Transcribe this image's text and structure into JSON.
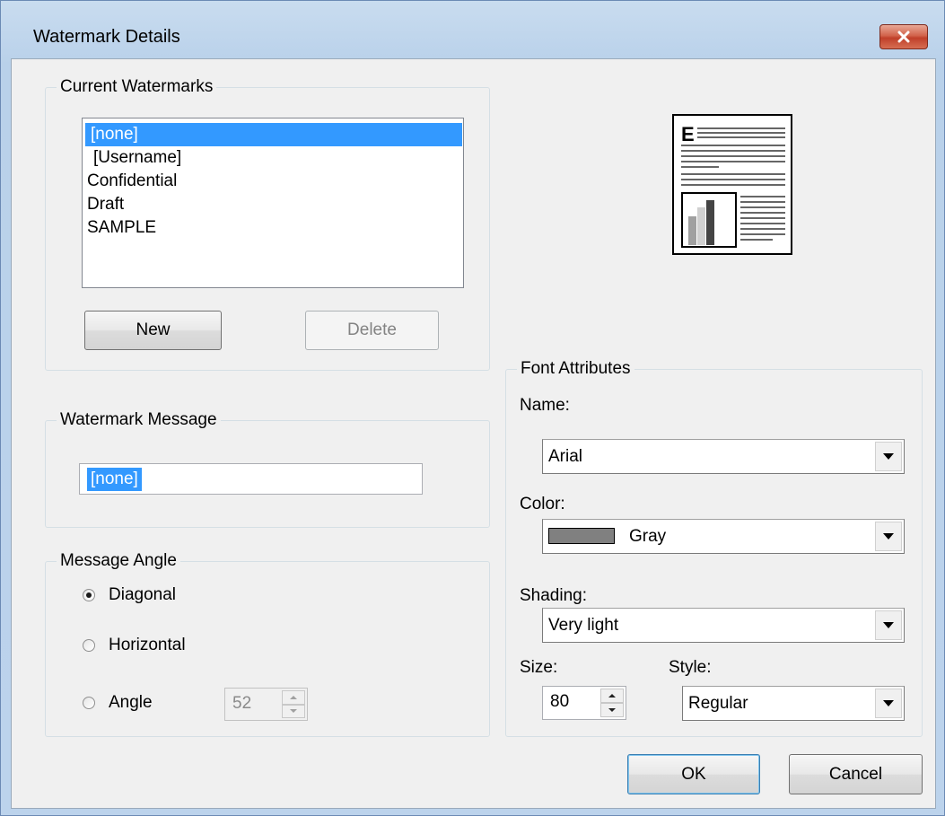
{
  "window": {
    "title": "Watermark Details"
  },
  "current_watermarks": {
    "group_label": "Current Watermarks",
    "items": [
      {
        "label": "[none]",
        "selected": true
      },
      {
        "label": "[Username]"
      },
      {
        "label": "Confidential"
      },
      {
        "label": "Draft"
      },
      {
        "label": "SAMPLE"
      }
    ],
    "new_label": "New",
    "delete_label": "Delete"
  },
  "watermark_message": {
    "group_label": "Watermark Message",
    "value": "[none]"
  },
  "message_angle": {
    "group_label": "Message Angle",
    "diagonal_label": "Diagonal",
    "horizontal_label": "Horizontal",
    "angle_label": "Angle",
    "selected": "Diagonal",
    "angle_value": "52"
  },
  "font_attributes": {
    "group_label": "Font Attributes",
    "name_label": "Name:",
    "name_value": "Arial",
    "color_label": "Color:",
    "color_value": "Gray",
    "color_swatch": "#808080",
    "shading_label": "Shading:",
    "shading_value": "Very light",
    "size_label": "Size:",
    "size_value": "80",
    "style_label": "Style:",
    "style_value": "Regular"
  },
  "footer": {
    "ok_label": "OK",
    "cancel_label": "Cancel"
  },
  "preview": {
    "icon": "document-preview-icon",
    "letter": "E"
  }
}
